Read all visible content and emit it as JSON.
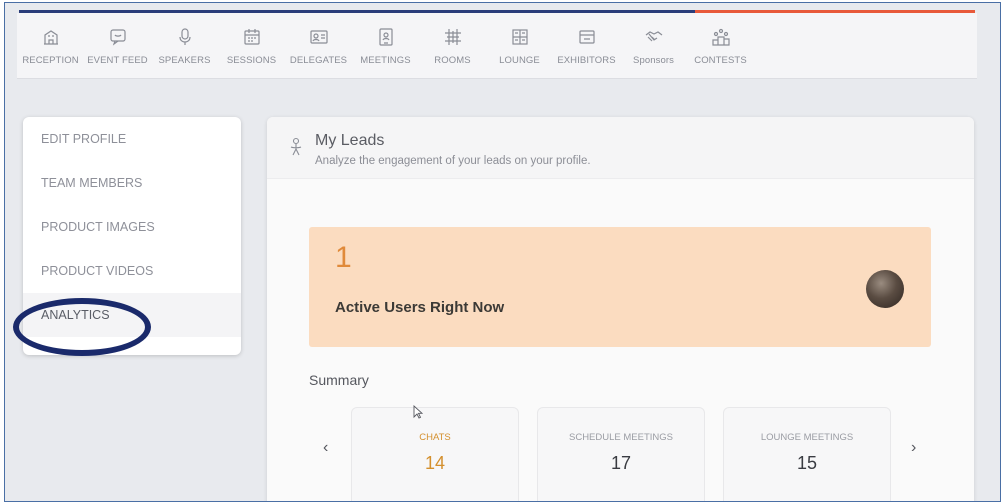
{
  "nav": {
    "items": [
      {
        "label": "RECEPTION",
        "icon": "building-icon"
      },
      {
        "label": "EVENT FEED",
        "icon": "chat-bubble-icon"
      },
      {
        "label": "SPEAKERS",
        "icon": "microphone-icon"
      },
      {
        "label": "SESSIONS",
        "icon": "calendar-icon"
      },
      {
        "label": "DELEGATES",
        "icon": "id-card-icon"
      },
      {
        "label": "MEETINGS",
        "icon": "badge-icon"
      },
      {
        "label": "ROOMS",
        "icon": "grid-icon"
      },
      {
        "label": "LOUNGE",
        "icon": "table-icon"
      },
      {
        "label": "EXHIBITORS",
        "icon": "booth-icon"
      },
      {
        "label": "Sponsors",
        "icon": "handshake-icon"
      },
      {
        "label": "CONTESTS",
        "icon": "podium-icon"
      }
    ]
  },
  "sidebar": {
    "items": [
      {
        "label": "EDIT PROFILE"
      },
      {
        "label": "TEAM MEMBERS"
      },
      {
        "label": "PRODUCT IMAGES"
      },
      {
        "label": "PRODUCT VIDEOS"
      },
      {
        "label": "ANALYTICS",
        "active": true
      }
    ]
  },
  "main": {
    "title": "My Leads",
    "subtitle": "Analyze the engagement of your leads on your profile.",
    "active_users": {
      "count": "1",
      "label": "Active Users Right Now"
    },
    "summary_title": "Summary",
    "prev_arrow": "‹",
    "next_arrow": "›",
    "stats": [
      {
        "label": "CHATS",
        "value": "14",
        "selected": true
      },
      {
        "label": "SCHEDULE MEETINGS",
        "value": "17"
      },
      {
        "label": "LOUNGE MEETINGS",
        "value": "15"
      }
    ]
  },
  "colors": {
    "accent_navy": "#2a3d7a",
    "accent_orange": "#e8593a",
    "card_peach": "#fbdcc0",
    "count_orange": "#e08a3a",
    "highlight_ring": "#1a2a6b"
  }
}
